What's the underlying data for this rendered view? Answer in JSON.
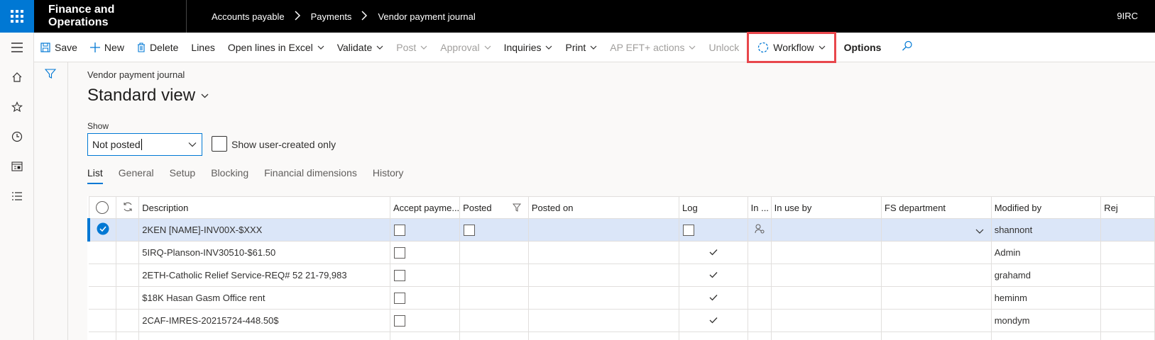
{
  "topbar": {
    "app_title": "Finance and Operations",
    "breadcrumb": [
      "Accounts payable",
      "Payments",
      "Vendor payment journal"
    ],
    "company": "9IRC"
  },
  "leftnav": [
    "hamburger-icon",
    "home-icon",
    "star-icon",
    "clock-icon",
    "workspace-icon",
    "list-icon"
  ],
  "actions": {
    "save": "Save",
    "new": "New",
    "delete": "Delete",
    "lines": "Lines",
    "open_excel": "Open lines in Excel",
    "validate": "Validate",
    "post": "Post",
    "approval": "Approval",
    "inquiries": "Inquiries",
    "print": "Print",
    "ap_eft": "AP EFT+ actions",
    "unlock": "Unlock",
    "workflow": "Workflow",
    "options": "Options"
  },
  "page": {
    "caption": "Vendor payment journal",
    "view_title": "Standard view",
    "show_label": "Show",
    "show_value": "Not posted",
    "user_created_label": "Show user-created only"
  },
  "tabs": [
    "List",
    "General",
    "Setup",
    "Blocking",
    "Financial dimensions",
    "History"
  ],
  "grid": {
    "columns": {
      "description": "Description",
      "accept": "Accept payme...",
      "posted": "Posted",
      "posted_on": "Posted on",
      "log": "Log",
      "in_use": "In ...",
      "in_use_by": "In use by",
      "fs_department": "FS department",
      "modified_by": "Modified by",
      "rej": "Rej"
    },
    "rows": [
      {
        "description": "2KEN [NAME]-INV00X-$XXX",
        "modified_by": "shannont",
        "log": false,
        "selected": true
      },
      {
        "description": "5IRQ-Planson-INV30510-$61.50",
        "modified_by": "Admin",
        "log": true,
        "selected": false
      },
      {
        "description": "2ETH-Catholic Relief Service-REQ# 52 21-79,983",
        "modified_by": "grahamd",
        "log": true,
        "selected": false
      },
      {
        "description": "$18K Hasan Gasm Office rent",
        "modified_by": "heminm",
        "log": true,
        "selected": false
      },
      {
        "description": "2CAF-IMRES-20215724-448.50$",
        "modified_by": "mondym",
        "log": true,
        "selected": false
      }
    ]
  },
  "colors": {
    "accent": "#0078d4",
    "highlight_box": "#e8474c",
    "selected_row": "#dbe6f8"
  }
}
